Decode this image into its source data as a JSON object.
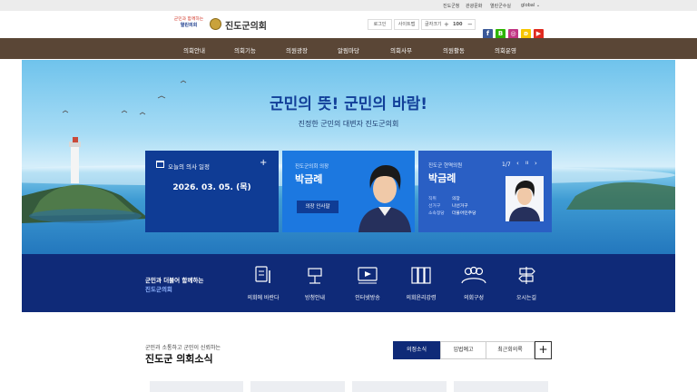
{
  "utility_links": [
    "진도군청",
    "관광문화",
    "열린군수실",
    "global"
  ],
  "logo": {
    "slogan_top": "군민과 함께하는",
    "slogan_bottom": "열린의회",
    "name": "진도군의회"
  },
  "header_tools": {
    "login": "로그인",
    "sitemap": "사이트맵",
    "font_label": "글자크기",
    "zoom": "100"
  },
  "social": [
    {
      "name": "facebook-icon",
      "char": "f",
      "color": "#3b5998"
    },
    {
      "name": "blog-icon",
      "char": "B",
      "color": "#2db400"
    },
    {
      "name": "instagram-icon",
      "char": "◎",
      "color": "#c13584"
    },
    {
      "name": "kakao-icon",
      "char": "ʚ",
      "color": "#f7c600"
    },
    {
      "name": "youtube-icon",
      "char": "▶",
      "color": "#e02a1f"
    }
  ],
  "nav": [
    "의회안내",
    "의회기능",
    "의원광장",
    "알림마당",
    "의회사무",
    "의원활동",
    "의회운영"
  ],
  "hero": {
    "title": "군민의 뜻!  군민의 바람!",
    "subtitle": "진정한 군민의 대변자 진도군의회"
  },
  "schedule": {
    "title": "오늘의 의사 일정",
    "date": "2026. 03. 05. (목)"
  },
  "speaker": {
    "role": "진도군의회 의장",
    "name": "박금례",
    "button": "의장 인사말"
  },
  "member": {
    "role": "진도군 현역의원",
    "name": "박금례",
    "pager": "1/7",
    "rows": [
      {
        "k": "직위",
        "v": "의장"
      },
      {
        "k": "선거구",
        "v": "나선거구"
      },
      {
        "k": "소속정당",
        "v": "더불어민주당"
      }
    ]
  },
  "quick": {
    "title_line1": "군민과 더불어 함께하는",
    "title_line2": "진도군의회",
    "items": [
      "의회에 바란다",
      "방청안내",
      "인터넷방송",
      "의회윤리강령",
      "의회구성",
      "오시는길"
    ]
  },
  "news": {
    "small": "군민과 소통하고 군민이 신뢰하는",
    "title": "진도군 의회소식",
    "tabs": [
      "의정소식",
      "입법예고",
      "최근회의록"
    ],
    "more": "+"
  },
  "colors": {
    "nav": "#5a4636",
    "navy": "#0f2a78",
    "blue": "#1b6fd6",
    "deep_blue": "#14449c"
  }
}
